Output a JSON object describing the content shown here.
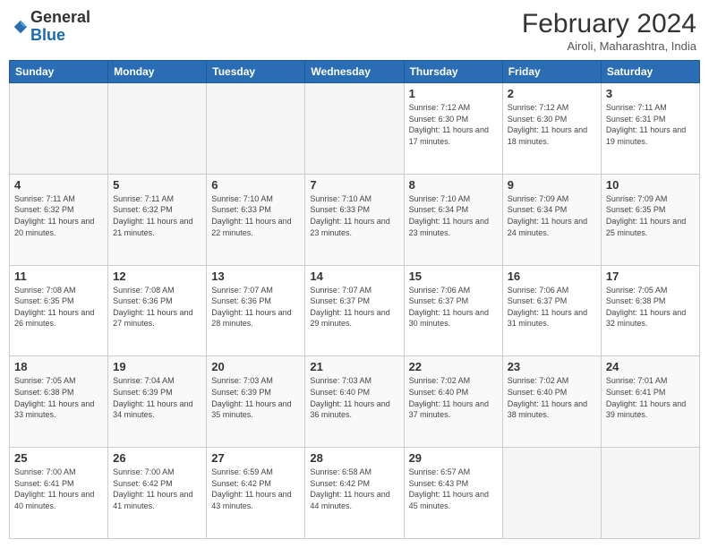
{
  "header": {
    "logo_general": "General",
    "logo_blue": "Blue",
    "title": "February 2024",
    "location": "Airoli, Maharashtra, India"
  },
  "days_of_week": [
    "Sunday",
    "Monday",
    "Tuesday",
    "Wednesday",
    "Thursday",
    "Friday",
    "Saturday"
  ],
  "weeks": [
    [
      {
        "day": "",
        "info": ""
      },
      {
        "day": "",
        "info": ""
      },
      {
        "day": "",
        "info": ""
      },
      {
        "day": "",
        "info": ""
      },
      {
        "day": "1",
        "info": "Sunrise: 7:12 AM\nSunset: 6:30 PM\nDaylight: 11 hours and 17 minutes."
      },
      {
        "day": "2",
        "info": "Sunrise: 7:12 AM\nSunset: 6:30 PM\nDaylight: 11 hours and 18 minutes."
      },
      {
        "day": "3",
        "info": "Sunrise: 7:11 AM\nSunset: 6:31 PM\nDaylight: 11 hours and 19 minutes."
      }
    ],
    [
      {
        "day": "4",
        "info": "Sunrise: 7:11 AM\nSunset: 6:32 PM\nDaylight: 11 hours and 20 minutes."
      },
      {
        "day": "5",
        "info": "Sunrise: 7:11 AM\nSunset: 6:32 PM\nDaylight: 11 hours and 21 minutes."
      },
      {
        "day": "6",
        "info": "Sunrise: 7:10 AM\nSunset: 6:33 PM\nDaylight: 11 hours and 22 minutes."
      },
      {
        "day": "7",
        "info": "Sunrise: 7:10 AM\nSunset: 6:33 PM\nDaylight: 11 hours and 23 minutes."
      },
      {
        "day": "8",
        "info": "Sunrise: 7:10 AM\nSunset: 6:34 PM\nDaylight: 11 hours and 23 minutes."
      },
      {
        "day": "9",
        "info": "Sunrise: 7:09 AM\nSunset: 6:34 PM\nDaylight: 11 hours and 24 minutes."
      },
      {
        "day": "10",
        "info": "Sunrise: 7:09 AM\nSunset: 6:35 PM\nDaylight: 11 hours and 25 minutes."
      }
    ],
    [
      {
        "day": "11",
        "info": "Sunrise: 7:08 AM\nSunset: 6:35 PM\nDaylight: 11 hours and 26 minutes."
      },
      {
        "day": "12",
        "info": "Sunrise: 7:08 AM\nSunset: 6:36 PM\nDaylight: 11 hours and 27 minutes."
      },
      {
        "day": "13",
        "info": "Sunrise: 7:07 AM\nSunset: 6:36 PM\nDaylight: 11 hours and 28 minutes."
      },
      {
        "day": "14",
        "info": "Sunrise: 7:07 AM\nSunset: 6:37 PM\nDaylight: 11 hours and 29 minutes."
      },
      {
        "day": "15",
        "info": "Sunrise: 7:06 AM\nSunset: 6:37 PM\nDaylight: 11 hours and 30 minutes."
      },
      {
        "day": "16",
        "info": "Sunrise: 7:06 AM\nSunset: 6:37 PM\nDaylight: 11 hours and 31 minutes."
      },
      {
        "day": "17",
        "info": "Sunrise: 7:05 AM\nSunset: 6:38 PM\nDaylight: 11 hours and 32 minutes."
      }
    ],
    [
      {
        "day": "18",
        "info": "Sunrise: 7:05 AM\nSunset: 6:38 PM\nDaylight: 11 hours and 33 minutes."
      },
      {
        "day": "19",
        "info": "Sunrise: 7:04 AM\nSunset: 6:39 PM\nDaylight: 11 hours and 34 minutes."
      },
      {
        "day": "20",
        "info": "Sunrise: 7:03 AM\nSunset: 6:39 PM\nDaylight: 11 hours and 35 minutes."
      },
      {
        "day": "21",
        "info": "Sunrise: 7:03 AM\nSunset: 6:40 PM\nDaylight: 11 hours and 36 minutes."
      },
      {
        "day": "22",
        "info": "Sunrise: 7:02 AM\nSunset: 6:40 PM\nDaylight: 11 hours and 37 minutes."
      },
      {
        "day": "23",
        "info": "Sunrise: 7:02 AM\nSunset: 6:40 PM\nDaylight: 11 hours and 38 minutes."
      },
      {
        "day": "24",
        "info": "Sunrise: 7:01 AM\nSunset: 6:41 PM\nDaylight: 11 hours and 39 minutes."
      }
    ],
    [
      {
        "day": "25",
        "info": "Sunrise: 7:00 AM\nSunset: 6:41 PM\nDaylight: 11 hours and 40 minutes."
      },
      {
        "day": "26",
        "info": "Sunrise: 7:00 AM\nSunset: 6:42 PM\nDaylight: 11 hours and 41 minutes."
      },
      {
        "day": "27",
        "info": "Sunrise: 6:59 AM\nSunset: 6:42 PM\nDaylight: 11 hours and 43 minutes."
      },
      {
        "day": "28",
        "info": "Sunrise: 6:58 AM\nSunset: 6:42 PM\nDaylight: 11 hours and 44 minutes."
      },
      {
        "day": "29",
        "info": "Sunrise: 6:57 AM\nSunset: 6:43 PM\nDaylight: 11 hours and 45 minutes."
      },
      {
        "day": "",
        "info": ""
      },
      {
        "day": "",
        "info": ""
      }
    ]
  ]
}
